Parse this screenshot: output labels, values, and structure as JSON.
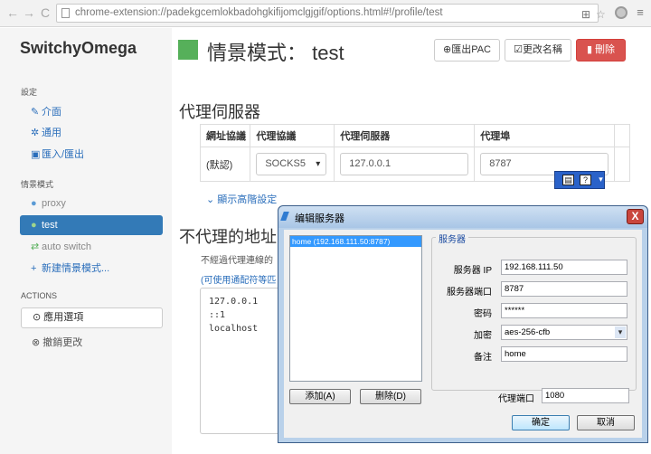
{
  "browser": {
    "back": "←",
    "forward": "→",
    "reload": "C",
    "url": "chrome-extension://padekgcemlokbadohgkifijomclgjgif/options.html#!/profile/test"
  },
  "sidebar": {
    "brand": "SwitchyOmega",
    "settings_label": "設定",
    "settings_items": [
      {
        "label": "介面",
        "icon": "wrench-icon"
      },
      {
        "label": "通用",
        "icon": "gear-icon"
      },
      {
        "label": "匯入/匯出",
        "icon": "floppy-icon"
      }
    ],
    "profiles_label": "情景模式",
    "profiles": [
      {
        "label": "proxy",
        "icon": "globe-icon",
        "color": "#5b9bd5"
      },
      {
        "label": "test",
        "icon": "globe-icon",
        "color": "#56b05a"
      },
      {
        "label": "auto switch",
        "icon": "switch-icon",
        "color": "#56b05a"
      }
    ],
    "new_profile": "新建情景模式...",
    "actions_label": "ACTIONS",
    "apply": "應用選項",
    "discard": "撤銷更改"
  },
  "header": {
    "title": "情景模式： test",
    "swatch_color": "#56b05a",
    "export_pac": "匯出PAC",
    "rename": "更改名稱",
    "delete": "刪除"
  },
  "proxy_section": {
    "title": "代理伺服器",
    "headers": [
      "網址協議",
      "代理協議",
      "代理伺服器",
      "代理埠"
    ],
    "row": {
      "scheme": "(默認)",
      "protocol": "SOCKS5",
      "server": "127.0.0.1",
      "port": "8787"
    },
    "advanced": "顯示高階設定"
  },
  "bypass_section": {
    "title": "不代理的地址",
    "desc": "不經過代理連線的",
    "hint": "(可使用通配符等匹",
    "list": [
      "127.0.0.1",
      "::1",
      "localhost"
    ]
  },
  "dialog": {
    "title": "编辑服务器",
    "close": "X",
    "list_item": "home (192.168.111.50:8787)",
    "add": "添加(A)",
    "delete": "删除(D)",
    "group_title": "服务器",
    "labels": {
      "ip": "服务器 IP",
      "port": "服务器端口",
      "password": "密码",
      "encryption": "加密",
      "remark": "备注",
      "local_port": "代理端口"
    },
    "values": {
      "ip": "192.168.111.50",
      "port": "8787",
      "password": "******",
      "encryption": "aes-256-cfb",
      "remark": "home",
      "local_port": "1080"
    },
    "ok": "确定",
    "cancel": "取消"
  }
}
